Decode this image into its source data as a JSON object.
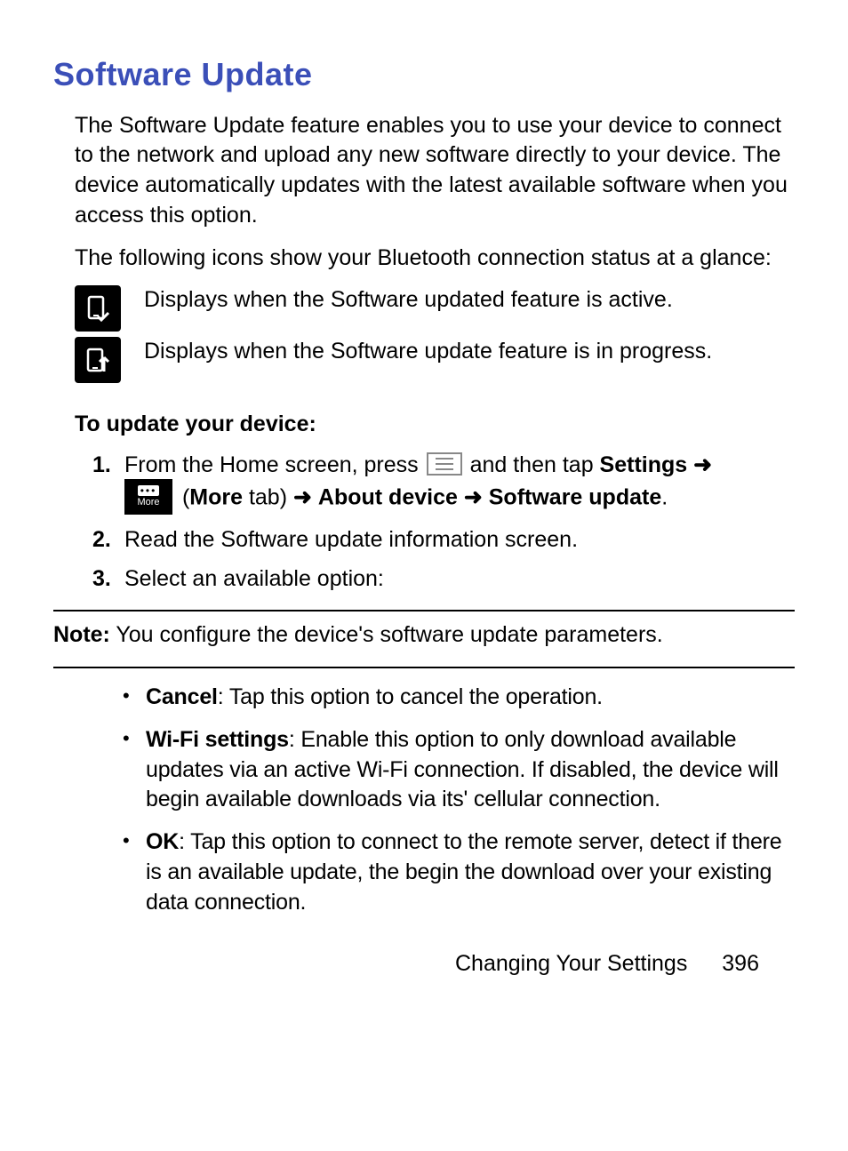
{
  "heading": "Software Update",
  "intro1": "The Software Update feature enables you to use your device to connect to the network and upload any new software directly to your device. The device automatically updates with the latest available software when you access this option.",
  "intro2": "The following icons show your Bluetooth connection status at a glance:",
  "iconrows": [
    "Displays when the Software updated feature is active.",
    "Displays when the Software update feature is in progress."
  ],
  "subhead": "To update your device:",
  "step1_a": "From the Home screen, press ",
  "step1_b": " and then tap ",
  "step1_settings": "Settings",
  "step1_more_paren_open": " (",
  "step1_more": "More",
  "step1_more_paren_close": " tab) ",
  "step1_about": "About device",
  "step1_sw": "Software update",
  "step1_period": ".",
  "step2": "Read the Software update information screen.",
  "step3": "Select an available option:",
  "more_label": "More",
  "note_label": "Note:",
  "note_text": " You configure the device's software update parameters.",
  "bullets": [
    {
      "b": "Cancel",
      "t": ": Tap this option to cancel the operation."
    },
    {
      "b": "Wi-Fi settings",
      "t": ": Enable this option to only download available updates via an active Wi-Fi connection. If disabled, the device will begin available downloads via its' cellular connection."
    },
    {
      "b": "OK",
      "t": ": Tap this option to connect to the remote server, detect if there is an available update, the begin the download over your existing data connection."
    }
  ],
  "footer_section": "Changing Your Settings",
  "footer_page": "396",
  "arrow": "➜"
}
